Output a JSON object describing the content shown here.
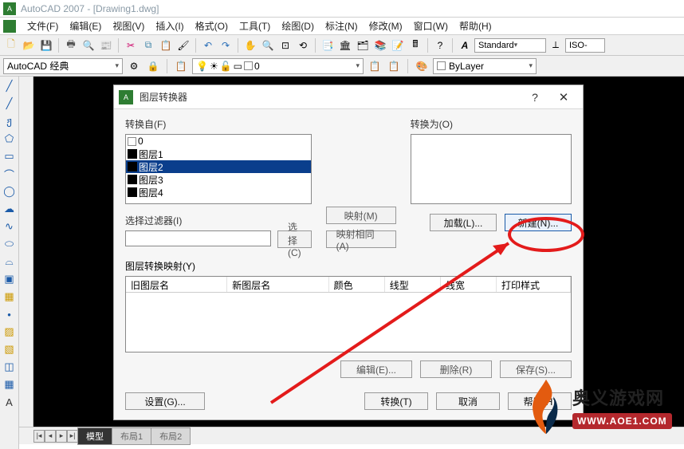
{
  "app": {
    "title": "AutoCAD 2007 - [Drawing1.dwg]"
  },
  "menu": {
    "file": "文件(F)",
    "edit": "编辑(E)",
    "view": "视图(V)",
    "insert": "插入(I)",
    "format": "格式(O)",
    "tools": "工具(T)",
    "draw": "绘图(D)",
    "dimension": "标注(N)",
    "modify": "修改(M)",
    "window": "窗口(W)",
    "help": "帮助(H)"
  },
  "style": {
    "text": "Standard",
    "dim": "ISO-"
  },
  "workspace": {
    "selected": "AutoCAD 经典"
  },
  "layer_dd": {
    "text": "0"
  },
  "color_dd": {
    "text": "ByLayer"
  },
  "tabs": {
    "model": "模型",
    "layout1": "布局1",
    "layout2": "布局2"
  },
  "dialog": {
    "title": "图层转换器",
    "convert_from_label": "转换自(F)",
    "convert_to_label": "转换为(O)",
    "from_items": [
      {
        "name": "0",
        "sw": "white"
      },
      {
        "name": "图层1",
        "sw": "black"
      },
      {
        "name": "图层2",
        "sw": "black",
        "sel": true
      },
      {
        "name": "图层3",
        "sw": "black"
      },
      {
        "name": "图层4",
        "sw": "black"
      }
    ],
    "filter_label": "选择过滤器(I)",
    "select_btn": "选择(C)",
    "map_btn": "映射(M)",
    "map_same_btn": "映射相同(A)",
    "load_btn": "加载(L)...",
    "new_btn": "新建(N)...",
    "mapping_label": "图层转换映射(Y)",
    "headers": {
      "old": "旧图层名",
      "new": "新图层名",
      "color": "颜色",
      "ltype": "线型",
      "lweight": "线宽",
      "pstyle": "打印样式"
    },
    "edit_btn": "编辑(E)...",
    "delete_btn": "删除(R)",
    "save_btn": "保存(S)...",
    "settings_btn": "设置(G)...",
    "convert_btn": "转换(T)",
    "cancel_btn": "取消",
    "help_btn": "帮助(H)"
  },
  "watermark": {
    "cn": "奥义游戏网",
    "en": "WWW.AOE1.COM"
  }
}
